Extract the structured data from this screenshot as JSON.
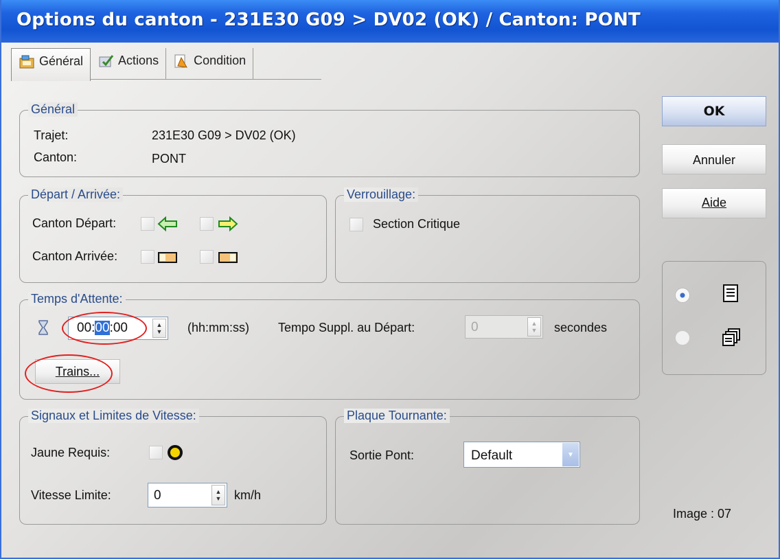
{
  "window": {
    "title": "Options du canton - 231E30 G09 > DV02 (OK) / Canton: PONT"
  },
  "tabs": [
    {
      "label": "Général",
      "icon": "general-icon"
    },
    {
      "label": "Actions",
      "icon": "actions-icon"
    },
    {
      "label": "Condition",
      "icon": "condition-icon"
    }
  ],
  "general": {
    "legend": "Général",
    "trajet_label": "Trajet:",
    "trajet_value": "231E30 G09 > DV02 (OK)",
    "canton_label": "Canton:",
    "canton_value": "PONT"
  },
  "depart_arrivee": {
    "legend": "Départ / Arrivée:",
    "canton_depart_label": "Canton Départ:",
    "canton_arrivee_label": "Canton Arrivée:"
  },
  "verrouillage": {
    "legend": "Verrouillage:",
    "section_critique_label": "Section Critique"
  },
  "temps_attente": {
    "legend": "Temps d'Attente:",
    "time_value_h": "00",
    "time_value_m": "00",
    "time_value_s": "00",
    "format_hint": "(hh:mm:ss)",
    "tempo_label": "Tempo Suppl. au Départ:",
    "tempo_value": "0",
    "tempo_unit": "secondes",
    "trains_button": "Trains..."
  },
  "signaux": {
    "legend": "Signaux et Limites de Vitesse:",
    "jaune_label": "Jaune Requis:",
    "vitesse_label": "Vitesse Limite:",
    "vitesse_value": "0",
    "vitesse_unit": "km/h"
  },
  "plaque": {
    "legend": "Plaque Tournante:",
    "sortie_label": "Sortie Pont:",
    "sortie_value": "Default"
  },
  "buttons": {
    "ok": "OK",
    "annuler": "Annuler",
    "aide": "Aide"
  },
  "view_options": {
    "selected": "list"
  },
  "image_label": "Image : 07",
  "colors": {
    "title_bar": "#1254d2",
    "legend_text": "#2a4c8c",
    "annotation_circle": "#e02020"
  }
}
